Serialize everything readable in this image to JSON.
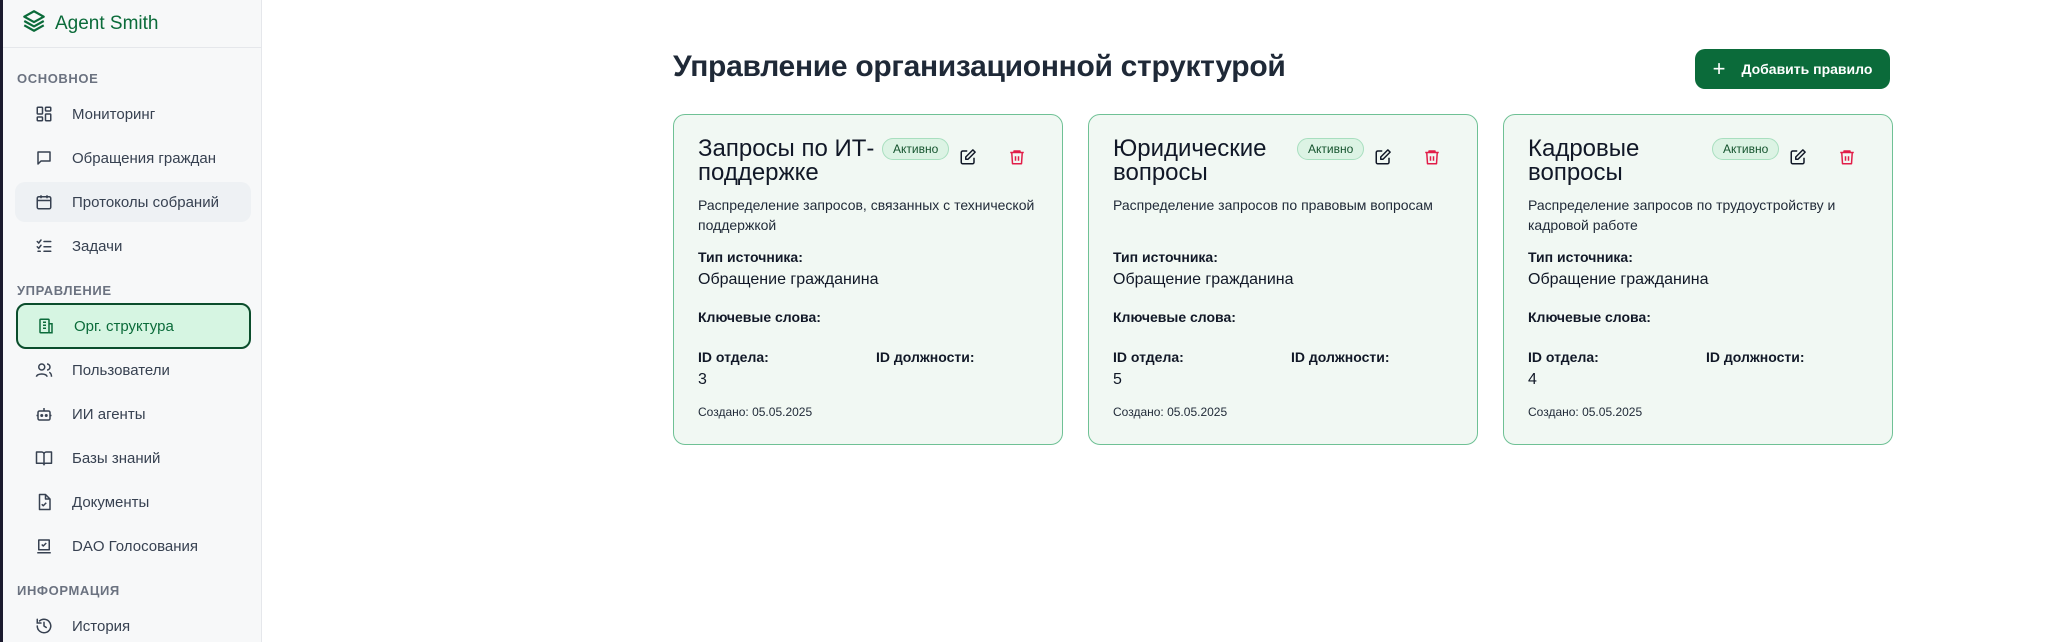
{
  "brand": {
    "name": "Agent Smith",
    "icon": "layers-icon",
    "color": "#0b6b3a"
  },
  "sidebar": {
    "sections": [
      {
        "title": "ОСНОВНОЕ"
      },
      {
        "title": "УПРАВЛЕНИЕ"
      },
      {
        "title": "ИНФОРМАЦИЯ"
      }
    ],
    "items": [
      {
        "label": "Мониторинг",
        "icon": "dashboard-icon"
      },
      {
        "label": "Обращения граждан",
        "icon": "message-icon"
      },
      {
        "label": "Протоколы собраний",
        "icon": "calendar-icon"
      },
      {
        "label": "Задачи",
        "icon": "checklist-icon"
      },
      {
        "label": "Орг. структура",
        "icon": "building-icon",
        "active": true
      },
      {
        "label": "Пользователи",
        "icon": "users-icon"
      },
      {
        "label": "ИИ агенты",
        "icon": "bot-icon"
      },
      {
        "label": "Базы знаний",
        "icon": "book-icon"
      },
      {
        "label": "Документы",
        "icon": "file-check-icon"
      },
      {
        "label": "DAO Голосования",
        "icon": "vote-icon"
      },
      {
        "label": "История",
        "icon": "history-icon"
      }
    ]
  },
  "main": {
    "title": "Управление организационной структурой",
    "add_button": "Добавить правило",
    "labels": {
      "source_type": "Тип источника:",
      "keywords": "Ключевые слова:",
      "dept_id": "ID отдела:",
      "position_id": "ID должности:"
    },
    "cards": [
      {
        "title": "Запросы по ИТ-поддержке",
        "status": "Активно",
        "description": "Распределение запросов, связанных с технической поддержкой",
        "source_type": "Обращение гражданина",
        "keywords": "",
        "dept_id": "3",
        "position_id": "",
        "created": "Создано: 05.05.2025"
      },
      {
        "title": "Юридические вопросы",
        "status": "Активно",
        "description": "Распределение запросов по правовым вопросам",
        "source_type": "Обращение гражданина",
        "keywords": "",
        "dept_id": "5",
        "position_id": "",
        "created": "Создано: 05.05.2025"
      },
      {
        "title": "Кадровые вопросы",
        "status": "Активно",
        "description": "Распределение запросов по трудоустройству и кадровой работе",
        "source_type": "Обращение гражданина",
        "keywords": "",
        "dept_id": "4",
        "position_id": "",
        "created": "Создано: 05.05.2025"
      }
    ]
  },
  "colors": {
    "accent": "#0b6b3a",
    "card_bg": "#f1f8f3",
    "card_border": "#6fc195",
    "delete": "#e11d48",
    "active_nav_bg": "#d6f5e2"
  }
}
